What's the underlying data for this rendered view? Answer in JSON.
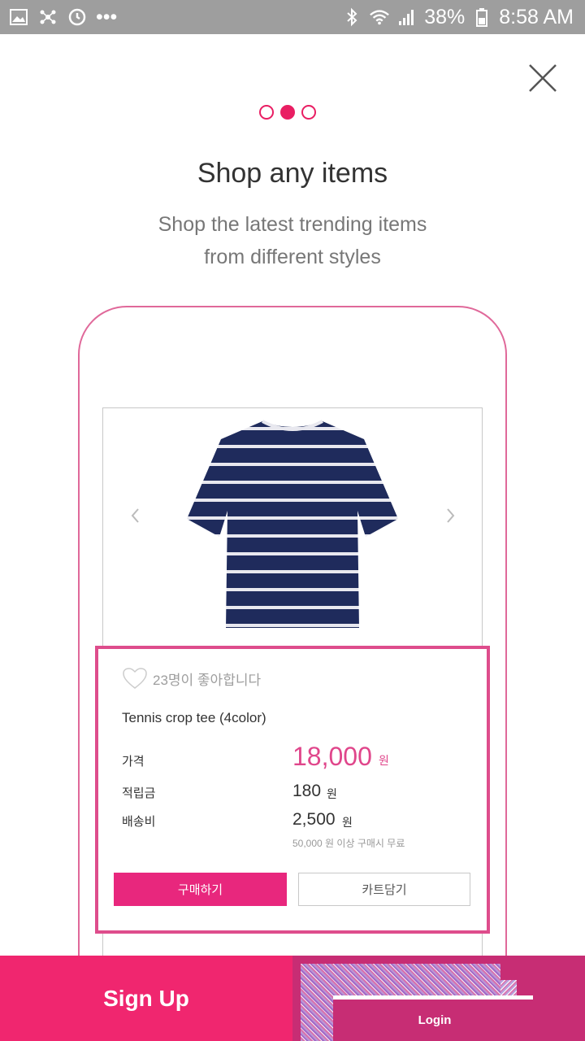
{
  "status_bar": {
    "battery": "38%",
    "time": "8:58 AM",
    "more": "•••",
    "left_icons": [
      "image-icon",
      "network-icon",
      "sync-icon",
      "more-icon"
    ],
    "right_icons": [
      "bluetooth-icon",
      "wifi-icon",
      "signal-icon",
      "battery-icon"
    ]
  },
  "onboarding": {
    "page_count": 3,
    "active_page": 2,
    "title": "Shop any items",
    "subtitle_line1": "Shop the latest trending items",
    "subtitle_line2": "from different styles"
  },
  "product": {
    "likes": "23명이 좋아합니다",
    "name": "Tennis crop tee (4color)",
    "price_label": "가격",
    "price": "18,000",
    "price_unit": "원",
    "points_label": "적립금",
    "points": "180",
    "points_unit": "원",
    "shipping_label": "배송비",
    "shipping": "2,500",
    "shipping_unit": "원",
    "shipping_note": "50,000 원 이상 구매시 무료",
    "buy_label": "구매하기",
    "cart_label": "카트담기"
  },
  "actions": {
    "signup_label": "Sign Up",
    "login_label": "Login"
  },
  "colors": {
    "accent": "#e91e63",
    "signup_bg": "#f0266f",
    "login_bg": "#c72d74",
    "price": "#e0468b",
    "status_bar": "#9e9e9e"
  }
}
